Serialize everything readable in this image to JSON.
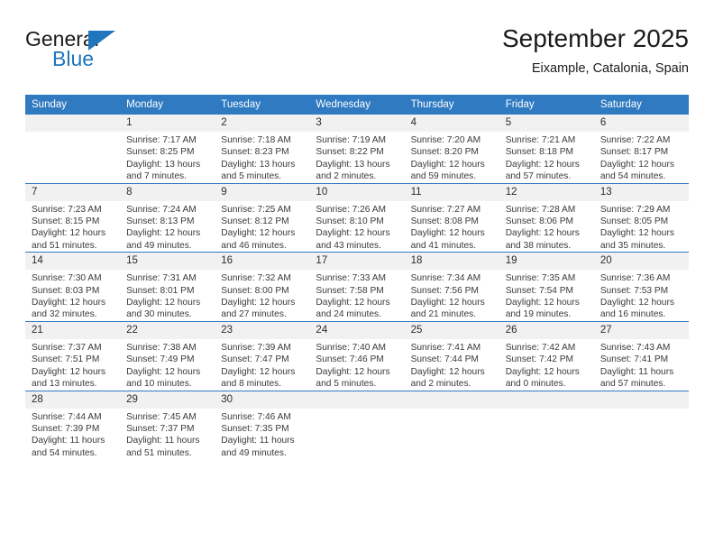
{
  "brand": {
    "name_top": "General",
    "name_bottom": "Blue",
    "accent_color": "#1f76bc",
    "triangle_icon": "triangle-icon"
  },
  "header": {
    "title": "September 2025",
    "subtitle": "Eixample, Catalonia, Spain"
  },
  "calendar": {
    "header_bg": "#2f7ac1",
    "daynum_bg": "#f1f1f1",
    "weekdays": [
      "Sunday",
      "Monday",
      "Tuesday",
      "Wednesday",
      "Thursday",
      "Friday",
      "Saturday"
    ],
    "weeks": [
      [
        {
          "day": "",
          "empty": true
        },
        {
          "day": "1",
          "sunrise": "Sunrise: 7:17 AM",
          "sunset": "Sunset: 8:25 PM",
          "daylight": "Daylight: 13 hours and 7 minutes."
        },
        {
          "day": "2",
          "sunrise": "Sunrise: 7:18 AM",
          "sunset": "Sunset: 8:23 PM",
          "daylight": "Daylight: 13 hours and 5 minutes."
        },
        {
          "day": "3",
          "sunrise": "Sunrise: 7:19 AM",
          "sunset": "Sunset: 8:22 PM",
          "daylight": "Daylight: 13 hours and 2 minutes."
        },
        {
          "day": "4",
          "sunrise": "Sunrise: 7:20 AM",
          "sunset": "Sunset: 8:20 PM",
          "daylight": "Daylight: 12 hours and 59 minutes."
        },
        {
          "day": "5",
          "sunrise": "Sunrise: 7:21 AM",
          "sunset": "Sunset: 8:18 PM",
          "daylight": "Daylight: 12 hours and 57 minutes."
        },
        {
          "day": "6",
          "sunrise": "Sunrise: 7:22 AM",
          "sunset": "Sunset: 8:17 PM",
          "daylight": "Daylight: 12 hours and 54 minutes."
        }
      ],
      [
        {
          "day": "7",
          "sunrise": "Sunrise: 7:23 AM",
          "sunset": "Sunset: 8:15 PM",
          "daylight": "Daylight: 12 hours and 51 minutes."
        },
        {
          "day": "8",
          "sunrise": "Sunrise: 7:24 AM",
          "sunset": "Sunset: 8:13 PM",
          "daylight": "Daylight: 12 hours and 49 minutes."
        },
        {
          "day": "9",
          "sunrise": "Sunrise: 7:25 AM",
          "sunset": "Sunset: 8:12 PM",
          "daylight": "Daylight: 12 hours and 46 minutes."
        },
        {
          "day": "10",
          "sunrise": "Sunrise: 7:26 AM",
          "sunset": "Sunset: 8:10 PM",
          "daylight": "Daylight: 12 hours and 43 minutes."
        },
        {
          "day": "11",
          "sunrise": "Sunrise: 7:27 AM",
          "sunset": "Sunset: 8:08 PM",
          "daylight": "Daylight: 12 hours and 41 minutes."
        },
        {
          "day": "12",
          "sunrise": "Sunrise: 7:28 AM",
          "sunset": "Sunset: 8:06 PM",
          "daylight": "Daylight: 12 hours and 38 minutes."
        },
        {
          "day": "13",
          "sunrise": "Sunrise: 7:29 AM",
          "sunset": "Sunset: 8:05 PM",
          "daylight": "Daylight: 12 hours and 35 minutes."
        }
      ],
      [
        {
          "day": "14",
          "sunrise": "Sunrise: 7:30 AM",
          "sunset": "Sunset: 8:03 PM",
          "daylight": "Daylight: 12 hours and 32 minutes."
        },
        {
          "day": "15",
          "sunrise": "Sunrise: 7:31 AM",
          "sunset": "Sunset: 8:01 PM",
          "daylight": "Daylight: 12 hours and 30 minutes."
        },
        {
          "day": "16",
          "sunrise": "Sunrise: 7:32 AM",
          "sunset": "Sunset: 8:00 PM",
          "daylight": "Daylight: 12 hours and 27 minutes."
        },
        {
          "day": "17",
          "sunrise": "Sunrise: 7:33 AM",
          "sunset": "Sunset: 7:58 PM",
          "daylight": "Daylight: 12 hours and 24 minutes."
        },
        {
          "day": "18",
          "sunrise": "Sunrise: 7:34 AM",
          "sunset": "Sunset: 7:56 PM",
          "daylight": "Daylight: 12 hours and 21 minutes."
        },
        {
          "day": "19",
          "sunrise": "Sunrise: 7:35 AM",
          "sunset": "Sunset: 7:54 PM",
          "daylight": "Daylight: 12 hours and 19 minutes."
        },
        {
          "day": "20",
          "sunrise": "Sunrise: 7:36 AM",
          "sunset": "Sunset: 7:53 PM",
          "daylight": "Daylight: 12 hours and 16 minutes."
        }
      ],
      [
        {
          "day": "21",
          "sunrise": "Sunrise: 7:37 AM",
          "sunset": "Sunset: 7:51 PM",
          "daylight": "Daylight: 12 hours and 13 minutes."
        },
        {
          "day": "22",
          "sunrise": "Sunrise: 7:38 AM",
          "sunset": "Sunset: 7:49 PM",
          "daylight": "Daylight: 12 hours and 10 minutes."
        },
        {
          "day": "23",
          "sunrise": "Sunrise: 7:39 AM",
          "sunset": "Sunset: 7:47 PM",
          "daylight": "Daylight: 12 hours and 8 minutes."
        },
        {
          "day": "24",
          "sunrise": "Sunrise: 7:40 AM",
          "sunset": "Sunset: 7:46 PM",
          "daylight": "Daylight: 12 hours and 5 minutes."
        },
        {
          "day": "25",
          "sunrise": "Sunrise: 7:41 AM",
          "sunset": "Sunset: 7:44 PM",
          "daylight": "Daylight: 12 hours and 2 minutes."
        },
        {
          "day": "26",
          "sunrise": "Sunrise: 7:42 AM",
          "sunset": "Sunset: 7:42 PM",
          "daylight": "Daylight: 12 hours and 0 minutes."
        },
        {
          "day": "27",
          "sunrise": "Sunrise: 7:43 AM",
          "sunset": "Sunset: 7:41 PM",
          "daylight": "Daylight: 11 hours and 57 minutes."
        }
      ],
      [
        {
          "day": "28",
          "sunrise": "Sunrise: 7:44 AM",
          "sunset": "Sunset: 7:39 PM",
          "daylight": "Daylight: 11 hours and 54 minutes."
        },
        {
          "day": "29",
          "sunrise": "Sunrise: 7:45 AM",
          "sunset": "Sunset: 7:37 PM",
          "daylight": "Daylight: 11 hours and 51 minutes."
        },
        {
          "day": "30",
          "sunrise": "Sunrise: 7:46 AM",
          "sunset": "Sunset: 7:35 PM",
          "daylight": "Daylight: 11 hours and 49 minutes."
        },
        {
          "day": "",
          "empty": true
        },
        {
          "day": "",
          "empty": true
        },
        {
          "day": "",
          "empty": true
        },
        {
          "day": "",
          "empty": true
        }
      ]
    ]
  }
}
